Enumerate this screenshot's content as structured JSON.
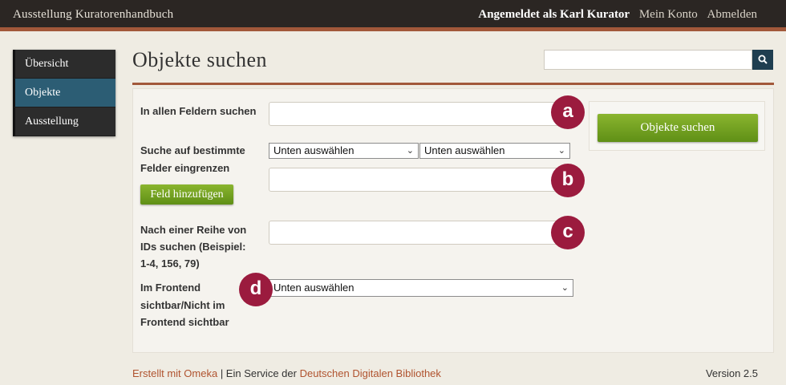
{
  "header": {
    "site_title": "Ausstellung Kuratorenhandbuch",
    "logged_in": "Angemeldet als Karl Kurator",
    "my_account": "Mein Konto",
    "logout": "Abmelden"
  },
  "sidebar": {
    "items": [
      {
        "label": "Übersicht",
        "active": false
      },
      {
        "label": "Objekte",
        "active": true
      },
      {
        "label": "Ausstellung",
        "active": false
      }
    ]
  },
  "page": {
    "title": "Objekte suchen",
    "search_placeholder": "",
    "search_icon": "search-icon"
  },
  "form": {
    "all_fields_label": "In allen Feldern suchen",
    "narrow_label_1": "Suche auf bestimmte",
    "narrow_label_2": "Felder eingrenzen",
    "field_select_1": "Unten auswählen",
    "field_select_2": "Unten auswählen",
    "add_field_button": "Feld hinzufügen",
    "ids_label_1": "Nach einer Reihe von",
    "ids_label_2": "IDs suchen (Beispiel:",
    "ids_label_3": "1-4, 156, 79)",
    "frontend_label_1": "Im Frontend",
    "frontend_label_2": "sichtbar/Nicht im",
    "frontend_label_3": "Frontend sichtbar",
    "frontend_select": "Unten auswählen",
    "submit_button": "Objekte suchen"
  },
  "markers": {
    "a": "a",
    "b": "b",
    "c": "c",
    "d": "d"
  },
  "footer": {
    "created_with": "Erstellt mit Omeka",
    "separator": "| Ein Service der",
    "ddb": "Deutschen Digitalen Bibliothek",
    "version": "Version 2.5"
  },
  "colors": {
    "accent": "#a2583a",
    "nav_active": "#2c5d74",
    "button_green": "#6e9e1e",
    "marker": "#9b1b3e",
    "search_button": "#1f3e50"
  }
}
